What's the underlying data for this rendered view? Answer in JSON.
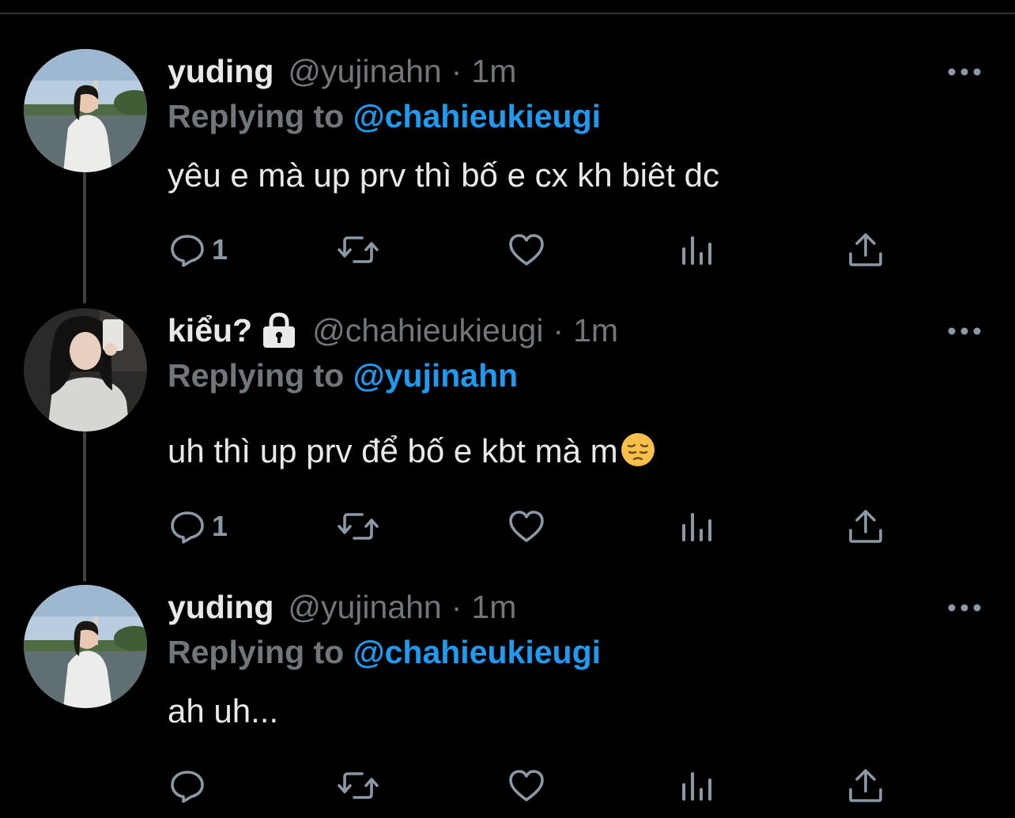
{
  "colors": {
    "background": "#000000",
    "text_primary": "#e7e9ea",
    "text_secondary": "#71767b",
    "link": "#1d9bf0",
    "icon": "#8b98a5",
    "thread_line": "#3e4144"
  },
  "reply_prefix": "Replying to",
  "tweets": [
    {
      "display_name": "yuding",
      "handle": "@yujinahn",
      "separator": "·",
      "time": "1m",
      "reply_to": "@chahieukieugi",
      "text": "yêu e mà up prv thì bố e cx kh biêt dc",
      "reply_count": "1",
      "avatar": "avatar-yuding-icon"
    },
    {
      "display_name": "kiểu?",
      "protected": true,
      "handle": "@chahieukieugi",
      "separator": "·",
      "time": "1m",
      "reply_to": "@yujinahn",
      "text": "uh thì up prv để bố e kbt mà m",
      "emoji": "pensive-face-emoji",
      "reply_count": "1",
      "avatar": "avatar-kieu-icon"
    },
    {
      "display_name": "yuding",
      "handle": "@yujinahn",
      "separator": "·",
      "time": "1m",
      "reply_to": "@chahieukieugi",
      "text": "ah uh...",
      "reply_count": "",
      "avatar": "avatar-yuding-icon"
    }
  ],
  "action_icons": [
    "reply-icon",
    "retweet-icon",
    "like-icon",
    "analytics-icon",
    "share-icon"
  ]
}
